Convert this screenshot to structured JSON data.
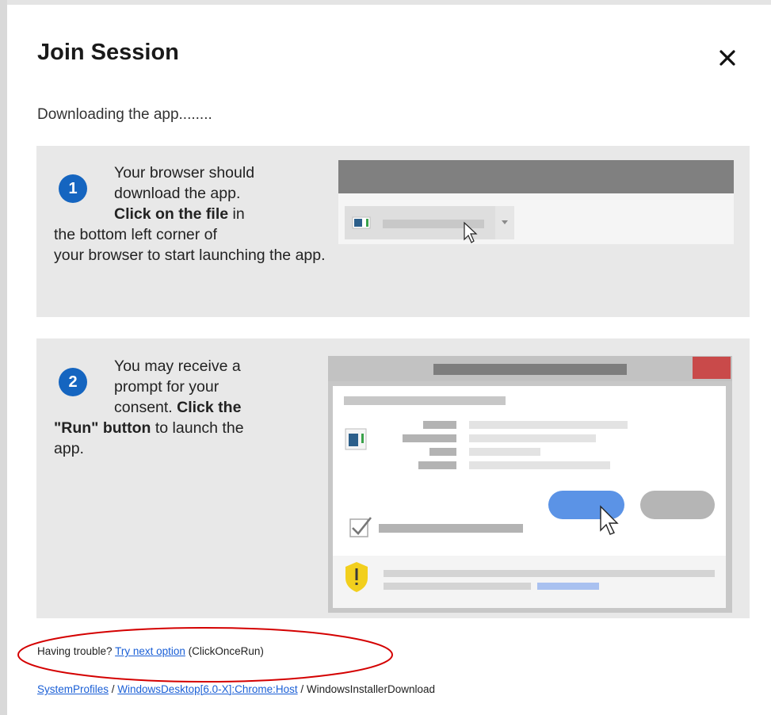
{
  "dialog": {
    "title": "Join Session",
    "close_symbol": "✕",
    "status": "Downloading the app........"
  },
  "steps": [
    {
      "number": "1",
      "line1": "Your browser should",
      "line2": "download the app.",
      "line3_bold": "Click on the file",
      "line3_rest": " in",
      "line4": "the bottom left corner of",
      "line5": "your browser to start launching the app."
    },
    {
      "number": "2",
      "line1": "You may receive a",
      "line2": "prompt for your",
      "line3_plain": "consent. ",
      "line3_bold": "Click the",
      "line4_bold": "\"Run\" button",
      "line4_rest": " to launch the",
      "line5": "app."
    }
  ],
  "footer": {
    "prefix": "Having trouble? ",
    "link": "Try next option",
    "suffix": " (ClickOnceRun)"
  },
  "breadcrumb": {
    "item1": "SystemProfiles",
    "sep1": " / ",
    "item2": "WindowsDesktop[6.0-X]:Chrome:Host",
    "sep2": " / ",
    "item3": "WindowsInstallerDownload"
  },
  "colors": {
    "badge": "#1565c0",
    "panel": "#e8e8e8",
    "run_button": "#5b93e6",
    "close_window": "#c94a4a",
    "annotation": "#d40000",
    "warning": "#f2cf1d"
  },
  "icons": {
    "close": "close-icon",
    "file": "file-icon",
    "cursor": "mouse-cursor-icon",
    "check": "checkbox-checked-icon",
    "warning": "shield-warning-icon"
  }
}
